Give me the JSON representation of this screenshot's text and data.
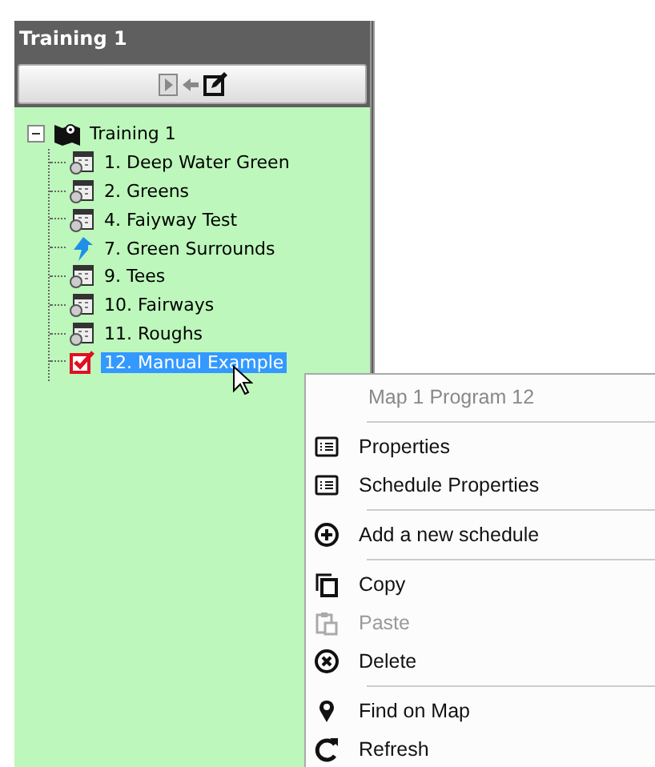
{
  "panel": {
    "title": "Training 1"
  },
  "tree": {
    "label": "Training 1",
    "expanded": true,
    "children": [
      {
        "label": "1. Deep Water Green",
        "kind": "schedule",
        "selected": false
      },
      {
        "label": "2. Greens",
        "kind": "schedule",
        "selected": false
      },
      {
        "label": "4. Faiyway Test",
        "kind": "schedule",
        "selected": false
      },
      {
        "label": "7. Green Surrounds",
        "kind": "arrow",
        "selected": false
      },
      {
        "label": "9. Tees",
        "kind": "schedule",
        "selected": false
      },
      {
        "label": "10. Fairways",
        "kind": "schedule",
        "selected": false
      },
      {
        "label": "11. Roughs",
        "kind": "schedule",
        "selected": false
      },
      {
        "label": "12. Manual Example",
        "kind": "manual",
        "selected": true
      }
    ]
  },
  "context_menu": {
    "title": "Map 1 Program 12",
    "items": [
      {
        "kind": "separator"
      },
      {
        "kind": "list",
        "label": "Properties",
        "disabled": false
      },
      {
        "kind": "list",
        "label": "Schedule Properties",
        "disabled": false
      },
      {
        "kind": "separator"
      },
      {
        "kind": "plus",
        "label": "Add a new schedule",
        "disabled": false
      },
      {
        "kind": "separator"
      },
      {
        "kind": "copy",
        "label": "Copy",
        "disabled": false
      },
      {
        "kind": "paste",
        "label": "Paste",
        "disabled": true
      },
      {
        "kind": "delete",
        "label": "Delete",
        "disabled": false
      },
      {
        "kind": "separator"
      },
      {
        "kind": "pin",
        "label": "Find on Map",
        "disabled": false
      },
      {
        "kind": "refresh",
        "label": "Refresh",
        "disabled": false
      }
    ]
  }
}
